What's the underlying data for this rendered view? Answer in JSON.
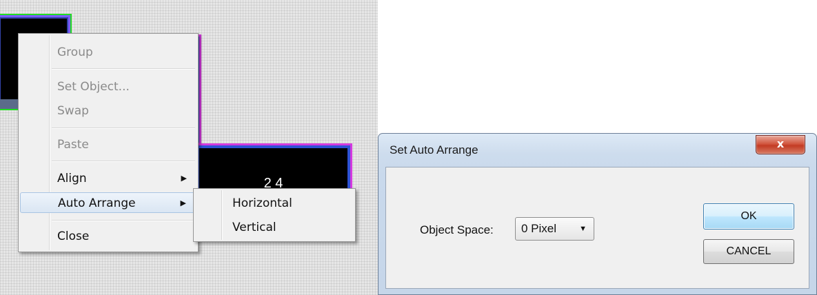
{
  "context_menu": {
    "items": [
      {
        "label": "Group",
        "disabled": true
      },
      {
        "label": "Set Object...",
        "disabled": true
      },
      {
        "label": "Swap",
        "disabled": true
      },
      {
        "label": "Paste",
        "disabled": true
      },
      {
        "label": "Align",
        "disabled": false,
        "has_submenu": true
      },
      {
        "label": "Auto Arrange",
        "disabled": false,
        "has_submenu": true,
        "highlighted": true
      },
      {
        "label": "Close",
        "disabled": false
      }
    ],
    "submenu_arrow": "▶"
  },
  "submenu": {
    "items": [
      {
        "label": "Horizontal"
      },
      {
        "label": "Vertical"
      }
    ]
  },
  "canvas": {
    "object_label": "2 4"
  },
  "dialog": {
    "title": "Set Auto Arrange",
    "close_glyph": "x",
    "object_space_label": "Object Space:",
    "object_space_value": "0 Pixel",
    "dropdown_arrow": "▼",
    "ok_label": "OK",
    "cancel_label": "CANCEL"
  },
  "colors": {
    "object_border_green": "#22dd22",
    "object_border_magenta": "#d43adf",
    "object_border_blue": "#2f52d6",
    "menu_highlight": "#dae6f3",
    "close_button_red": "#c33b24"
  }
}
